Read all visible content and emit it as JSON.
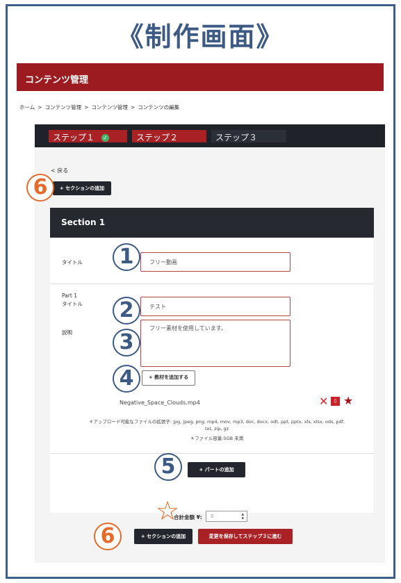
{
  "headline": "《制作画面》",
  "app": {
    "section_title": "コンテンツ管理"
  },
  "breadcrumb": [
    "ホーム",
    "コンテンツ管理",
    "コンテンツ管理",
    "コンテンツの編集"
  ],
  "breadcrumb_sep": ">",
  "steps": [
    {
      "label": "ステップ１",
      "state": "done"
    },
    {
      "label": "ステップ２",
      "state": "active"
    },
    {
      "label": "ステップ３",
      "state": "inactive"
    }
  ],
  "back_link": "< 戻る",
  "add_section_label": "+ セクションの追加",
  "section": {
    "name": "Section 1",
    "title_label": "タイトル",
    "title_value": "フリー動画",
    "part": {
      "name": "Part 1",
      "title_label": "タイトル",
      "title_value": "テスト",
      "desc_label": "説明",
      "desc_value": "フリー素材を使用しています。",
      "add_material_label": "+ 教材を追加する",
      "file_name": "Negative_Space_Clouds.mp4"
    },
    "upload_note_1": "＊アップロード可能なファイルの拡張子: jpg, jpeg, png, mp4, mov, mp3, doc, docx, odt, ppt, pptx, xls, xlsx, ods, pdf,",
    "upload_note_2": "txt, zip, gz",
    "size_note": "＊ファイル容量:5GB 未満",
    "add_part_label": "+ パートの追加"
  },
  "total": {
    "label": "合計金額 ¥:",
    "placeholder": "0"
  },
  "save_label": "変更を保存してステップ３に進む",
  "callouts": {
    "n1": "1",
    "n2": "2",
    "n3": "3",
    "n4": "4",
    "n5": "5",
    "n6": "6"
  },
  "colors": {
    "brand_red": "#9b1b20",
    "dark": "#23262d",
    "callout_blue": "#3c5a83",
    "callout_orange": "#e56b2a"
  },
  "icons": {
    "delete": "x-icon",
    "download": "download-icon",
    "favorite": "star-icon",
    "check": "check-icon"
  }
}
